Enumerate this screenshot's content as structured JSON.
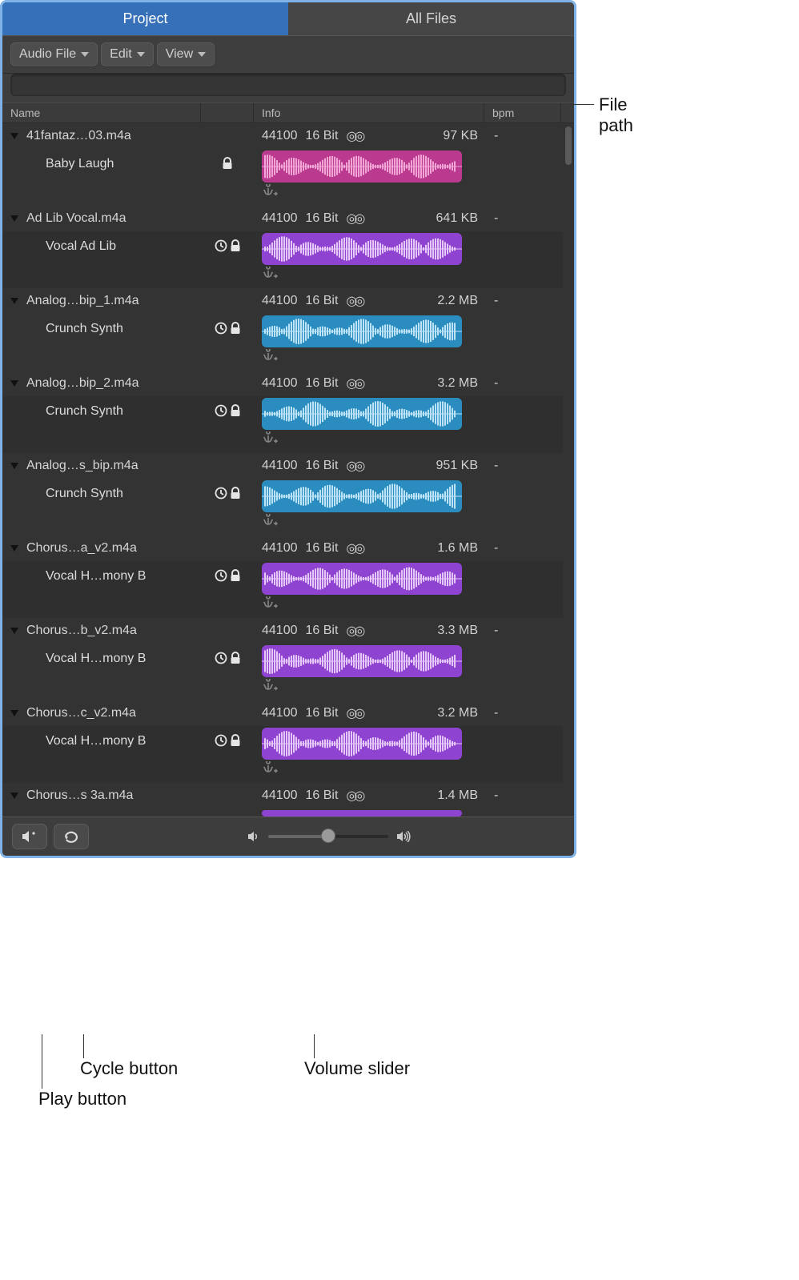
{
  "tabs": {
    "project": "Project",
    "allfiles": "All Files"
  },
  "toolbar": {
    "audio_file": "Audio File",
    "edit": "Edit",
    "view": "View"
  },
  "columns": {
    "name": "Name",
    "info": "Info",
    "bpm": "bpm"
  },
  "files": [
    {
      "name": "41fantaz…03.m4a",
      "sample_rate": "44100",
      "bit_depth": "16 Bit",
      "size": "97 KB",
      "bpm": "-",
      "region": "Baby Laugh",
      "has_clock": false,
      "color": "#b93a8f",
      "wave_light": "#f0a5d4"
    },
    {
      "name": "Ad Lib Vocal.m4a",
      "sample_rate": "44100",
      "bit_depth": "16 Bit",
      "size": "641 KB",
      "bpm": "-",
      "region": "Vocal Ad Lib",
      "has_clock": true,
      "color": "#8e44d0",
      "wave_light": "#e5c8f7"
    },
    {
      "name": "Analog…bip_1.m4a",
      "sample_rate": "44100",
      "bit_depth": "16 Bit",
      "size": "2.2 MB",
      "bpm": "-",
      "region": "Crunch Synth",
      "has_clock": true,
      "color": "#2b8dbf",
      "wave_light": "#bde3f6"
    },
    {
      "name": "Analog…bip_2.m4a",
      "sample_rate": "44100",
      "bit_depth": "16 Bit",
      "size": "3.2 MB",
      "bpm": "-",
      "region": "Crunch Synth",
      "has_clock": true,
      "color": "#2b8dbf",
      "wave_light": "#bde3f6"
    },
    {
      "name": "Analog…s_bip.m4a",
      "sample_rate": "44100",
      "bit_depth": "16 Bit",
      "size": "951 KB",
      "bpm": "-",
      "region": "Crunch Synth",
      "has_clock": true,
      "color": "#2b8dbf",
      "wave_light": "#bde3f6"
    },
    {
      "name": "Chorus…a_v2.m4a",
      "sample_rate": "44100",
      "bit_depth": "16 Bit",
      "size": "1.6 MB",
      "bpm": "-",
      "region": "Vocal H…mony B",
      "has_clock": true,
      "color": "#8e44d0",
      "wave_light": "#e5c8f7"
    },
    {
      "name": "Chorus…b_v2.m4a",
      "sample_rate": "44100",
      "bit_depth": "16 Bit",
      "size": "3.3 MB",
      "bpm": "-",
      "region": "Vocal H…mony B",
      "has_clock": true,
      "color": "#8e44d0",
      "wave_light": "#e5c8f7"
    },
    {
      "name": "Chorus…c_v2.m4a",
      "sample_rate": "44100",
      "bit_depth": "16 Bit",
      "size": "3.2 MB",
      "bpm": "-",
      "region": "Vocal H…mony B",
      "has_clock": true,
      "color": "#8e44d0",
      "wave_light": "#e5c8f7"
    },
    {
      "name": "Chorus…s 3a.m4a",
      "sample_rate": "44100",
      "bit_depth": "16 Bit",
      "size": "1.4 MB",
      "bpm": "-",
      "region": null,
      "has_clock": true,
      "color": "#8e44d0",
      "wave_light": "#e5c8f7"
    }
  ],
  "callouts": {
    "file_path": "File path",
    "cycle": "Cycle button",
    "volume": "Volume slider",
    "play": "Play button"
  }
}
